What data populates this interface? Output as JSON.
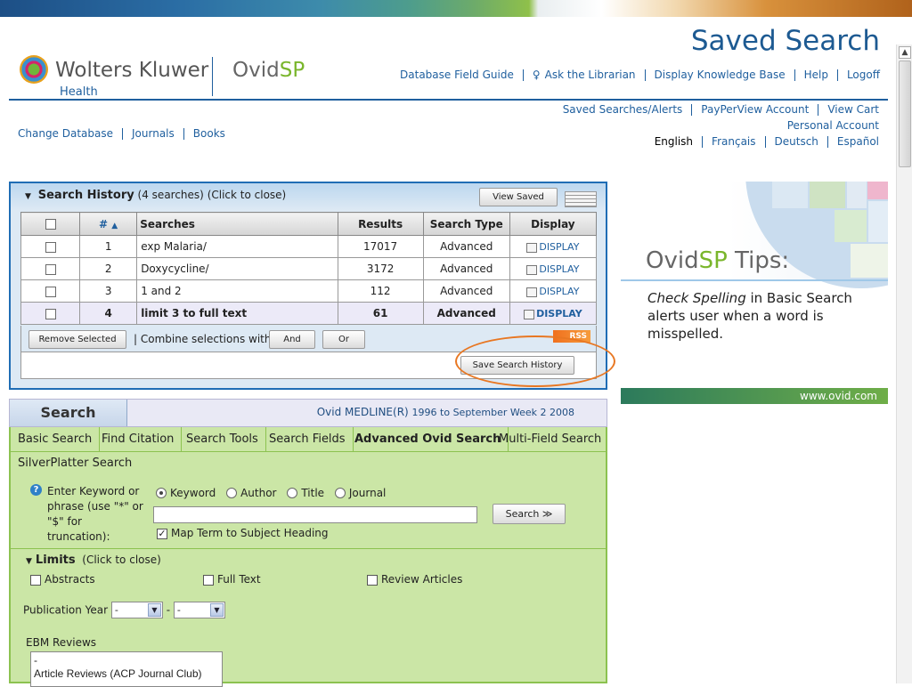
{
  "page": {
    "title": "Saved Search"
  },
  "brand": {
    "wk": "Wolters Kluwer",
    "health": "Health",
    "ovid": "Ovid",
    "sp": "SP"
  },
  "nav": [
    "Database Field Guide",
    "Ask the Librarian",
    "Display Knowledge Base",
    "Help",
    "Logoff"
  ],
  "account": {
    "row1": [
      "Saved Searches/Alerts",
      "PayPerView Account",
      "View Cart"
    ],
    "row2": "Personal Account"
  },
  "languages": [
    "English",
    "Français",
    "Deutsch",
    "Español"
  ],
  "db_links": [
    "Change Database",
    "Journals",
    "Books"
  ],
  "history": {
    "title": "Search History",
    "count": "(4 searches)",
    "hint": "(Click to close)",
    "view_saved": "View Saved",
    "columns": [
      "#",
      "Searches",
      "Results",
      "Search Type",
      "Display"
    ],
    "sort_indicator": "▲",
    "rows": [
      {
        "num": "1",
        "search": "exp Malaria/",
        "results": "17017",
        "type": "Advanced",
        "display": "DISPLAY"
      },
      {
        "num": "2",
        "search": "Doxycycline/",
        "results": "3172",
        "type": "Advanced",
        "display": "DISPLAY"
      },
      {
        "num": "3",
        "search": "1 and 2",
        "results": "112",
        "type": "Advanced",
        "display": "DISPLAY"
      },
      {
        "num": "4",
        "search": "limit 3 to full text",
        "results": "61",
        "type": "Advanced",
        "display": "DISPLAY"
      }
    ],
    "remove_selected": "Remove Selected",
    "combine_label": "| Combine selections with:",
    "and": "And",
    "or": "Or",
    "rss": "RSS",
    "save_history": "Save Search History"
  },
  "ad": {
    "title_ovid": "Ovid",
    "title_sp": "SP",
    "title_rest": " Tips:",
    "body_em": "Check Spelling",
    "body_rest": " in Basic Search alerts user when a word is misspelled.",
    "footer": "www.ovid.com"
  },
  "search": {
    "tab_label": "Search",
    "database": "Ovid MEDLINE(R)",
    "database_range": "1996 to September Week 2 2008",
    "tabs": [
      "Basic Search",
      "Find Citation",
      "Search Tools",
      "Search Fields",
      "Advanced Ovid Search",
      "Multi-Field Search",
      "SilverPlatter Search"
    ],
    "instructions": "Enter Keyword or phrase (use \"*\" or \"$\" for truncation):",
    "radio_options": [
      "Keyword",
      "Author",
      "Title",
      "Journal"
    ],
    "search_value": "",
    "search_button": "Search ≫",
    "map_term": "Map Term to Subject Heading"
  },
  "limits": {
    "title": "Limits",
    "hint": "(Click to close)",
    "options": [
      "Abstracts",
      "Full Text",
      "Review Articles"
    ],
    "pub_year_label": "Publication Year",
    "pub_year_from": "-",
    "pub_year_to": "-",
    "ebm_label": "EBM Reviews",
    "ebm_items": [
      "-",
      "Article Reviews (ACP Journal Club)"
    ]
  }
}
